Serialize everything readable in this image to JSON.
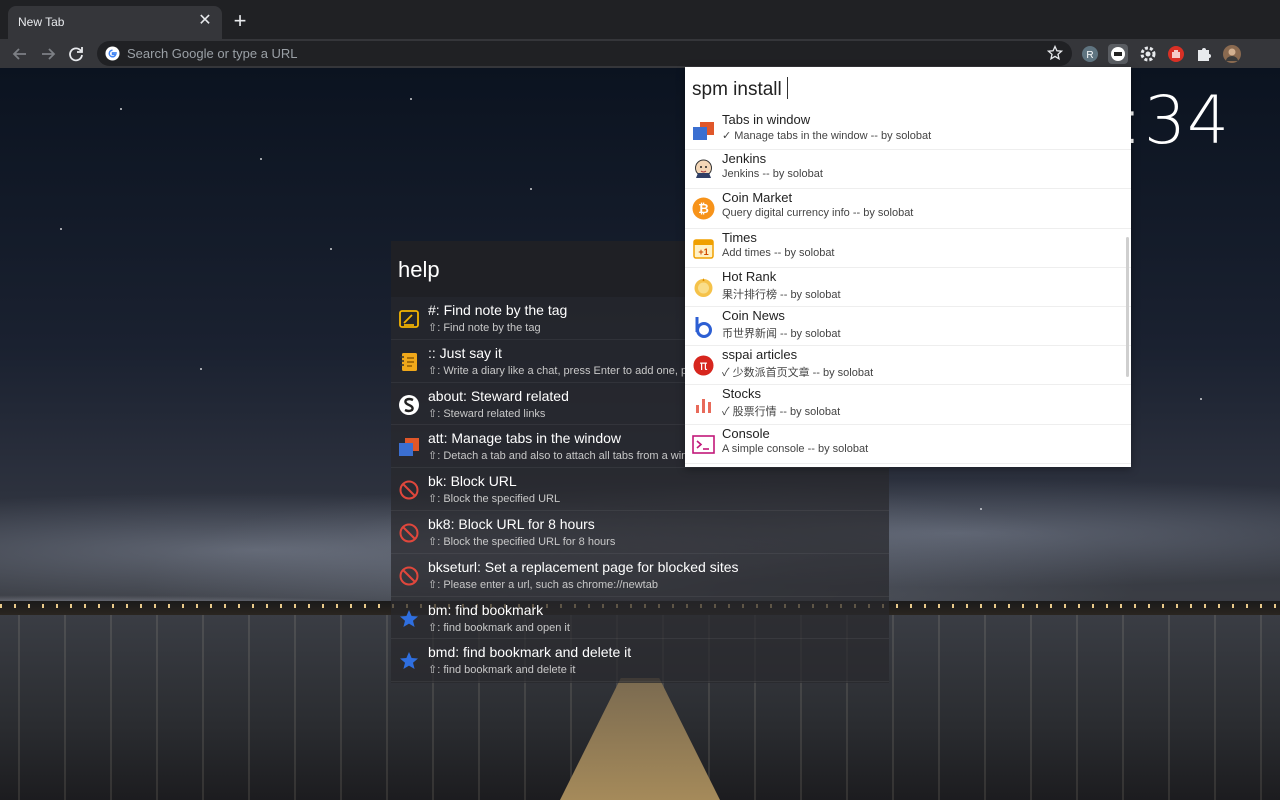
{
  "browser": {
    "tab_title": "New Tab",
    "tab_close": "✕",
    "new_tab": "+",
    "omnibox_placeholder": "Search Google or type a URL",
    "extensions": [
      "R"
    ]
  },
  "clock": ":34",
  "help": {
    "title": "help",
    "items": [
      {
        "icon": "note-tag-icon",
        "title": "#: Find note by the tag",
        "sub": "⇧: Find note by the tag"
      },
      {
        "icon": "notebook-icon",
        "title": ":: Just say it",
        "sub": "⇧: Write a diary like a chat, press Enter to add one, press Shift+Enter to add multiline"
      },
      {
        "icon": "steward-logo-icon",
        "title": "about: Steward related",
        "sub": "⇧: Steward related links"
      },
      {
        "icon": "tabs-icon",
        "title": "att: Manage tabs in the window",
        "sub": "⇧: Detach a tab and also to attach all tabs from a window"
      },
      {
        "icon": "block-icon",
        "title": "bk: Block URL",
        "sub": "⇧: Block the specified URL"
      },
      {
        "icon": "block-icon",
        "title": "bk8: Block URL for 8 hours",
        "sub": "⇧: Block the specified URL for 8 hours"
      },
      {
        "icon": "block-icon",
        "title": "bkseturl: Set a replacement page for blocked sites",
        "sub": "⇧: Please enter a url, such as chrome://newtab"
      },
      {
        "icon": "star-icon",
        "title": "bm: find bookmark",
        "sub": "⇧: find bookmark and open it"
      },
      {
        "icon": "star-icon",
        "title": "bmd: find bookmark and delete it",
        "sub": "⇧: find bookmark and delete it"
      }
    ]
  },
  "install": {
    "query": "spm install",
    "items": [
      {
        "icon": "tabs-icon",
        "title": "Tabs in window",
        "sub": "✓ Manage tabs in the window -- by solobat"
      },
      {
        "icon": "jenkins-icon",
        "title": "Jenkins",
        "sub": "Jenkins -- by solobat"
      },
      {
        "icon": "bitcoin-icon",
        "title": "Coin Market",
        "sub": "Query digital currency info -- by solobat"
      },
      {
        "icon": "calendar-plus-icon",
        "title": "Times",
        "sub": "Add times -- by solobat"
      },
      {
        "icon": "hot-rank-icon",
        "title": "Hot Rank",
        "sub": "果汁排行榜 -- by solobat"
      },
      {
        "icon": "coin-news-icon",
        "title": "Coin News",
        "sub": "币世界新闻 -- by solobat"
      },
      {
        "icon": "sspai-icon",
        "title": "sspai articles",
        "sub": "✓ 少数派首页文章 -- by solobat"
      },
      {
        "icon": "stocks-icon",
        "title": "Stocks",
        "sub": "✓ 股票行情 -- by solobat"
      },
      {
        "icon": "console-icon",
        "title": "Console",
        "sub": "A simple console -- by solobat"
      }
    ]
  }
}
